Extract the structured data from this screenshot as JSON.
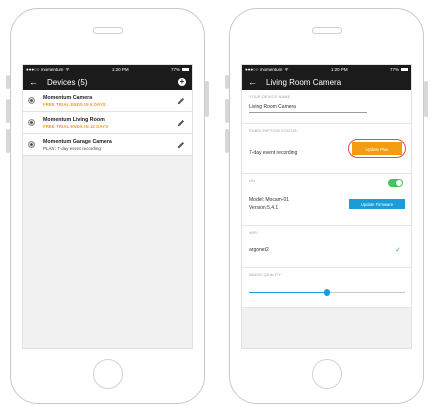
{
  "status_bar": {
    "carrier": "●●●○○ momentum",
    "wifi": "ᯤ",
    "time": "1:20 PM",
    "battery": "77%"
  },
  "devices_screen": {
    "title": "Devices (5)",
    "back_glyph": "←",
    "add_glyph": "+",
    "devices": [
      {
        "name": "Momentum Camera",
        "subtitle": "FREE TRIAL ENDS IN 5 DAYS",
        "kind": "trial"
      },
      {
        "name": "Momentum Living Room",
        "subtitle": "FREE TRIAL ENDS IN 12 DAYS",
        "kind": "trial"
      },
      {
        "name": "Momentum Garage Camera",
        "subtitle": "PLAN: 7-day event recording",
        "kind": "plan"
      }
    ]
  },
  "settings_screen": {
    "title": "Living Room Camera",
    "back_glyph": "←",
    "device_name_label": "YOUR DEVICE NAME",
    "device_name_value": "Living Room Camera",
    "subscription_label": "SUBSCRIPTION STATUS",
    "subscription_value": "7-day event recording",
    "update_plan_label": "Update Plan",
    "on_label": "ON",
    "toggle_on": true,
    "model_label": "Model: Mocam-01",
    "version_label": "Version:5.4.1",
    "update_firmware_label": "Update Firmware",
    "wifi_label": "WIFI",
    "wifi_value": "argonet2",
    "image_quality_label": "IMAGE QUALITY",
    "image_quality_level": 0.5
  },
  "icons": {
    "camera": "camera-icon",
    "edit": "pencil-icon",
    "add": "plus-circle-icon",
    "back": "arrow-left-icon",
    "check": "check-icon"
  },
  "colors": {
    "trial_text": "#f39c12",
    "update_plan": "#f39c12",
    "highlight_ring": "#e74c3c",
    "firmware_button": "#1a9cd8",
    "toggle_on": "#46c35d",
    "nav_bar": "#1b1b1b"
  }
}
